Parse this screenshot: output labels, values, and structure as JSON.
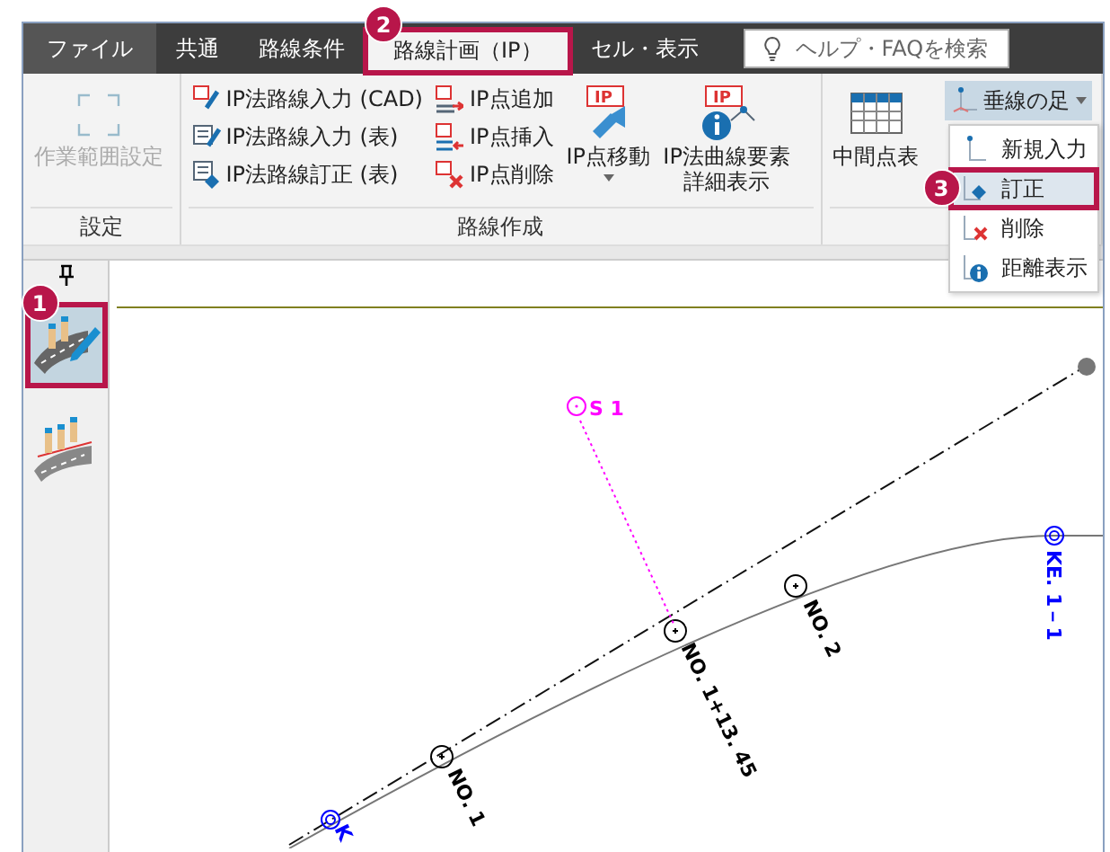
{
  "tabs": [
    {
      "label": "ファイル",
      "selected": false,
      "kind": "file"
    },
    {
      "label": "共通",
      "selected": false,
      "kind": "tab"
    },
    {
      "label": "路線条件",
      "selected": false,
      "kind": "tab"
    },
    {
      "label": "路線計画（IP）",
      "selected": true,
      "kind": "tab",
      "callout": "2"
    },
    {
      "label": "セル・表示",
      "selected": false,
      "kind": "tab"
    }
  ],
  "search": {
    "placeholder": "ヘルプ・FAQを検索"
  },
  "ribbon": {
    "groups": [
      {
        "label": "設定",
        "columns": [
          {
            "kind": "large",
            "items": [
              {
                "label": "作業範囲設定",
                "disabled": true
              }
            ]
          }
        ]
      },
      {
        "label": "路線作成",
        "columns": [
          {
            "kind": "small",
            "items": [
              {
                "label": "IP法路線入力 (CAD)",
                "disabled": false
              },
              {
                "label": "IP法路線入力 (表)",
                "disabled": false
              },
              {
                "label": "IP法路線訂正 (表)",
                "disabled": false
              }
            ]
          },
          {
            "kind": "small",
            "items": [
              {
                "label": "IP点追加",
                "disabled": false
              },
              {
                "label": "IP点挿入",
                "disabled": false
              },
              {
                "label": "IP点削除",
                "disabled": false
              }
            ]
          },
          {
            "kind": "large",
            "items": [
              {
                "label": "IP点移動",
                "disabled": false,
                "has_menu": true,
                "icon_text": "IP"
              },
              {
                "label": "IP法曲線要素詳細表示",
                "disabled": false,
                "has_menu": false,
                "icon_text": "IP"
              }
            ]
          }
        ]
      },
      {
        "columns": [
          {
            "kind": "large",
            "items": [
              {
                "label": "中間点表",
                "disabled": false,
                "has_menu": false
              }
            ]
          }
        ],
        "dropdown": {
          "label": "垂線の足",
          "expanded": true,
          "menu": [
            {
              "label": "新規入力",
              "selected": false
            },
            {
              "label": "訂正",
              "selected": true,
              "callout": "3"
            },
            {
              "label": "削除",
              "selected": false
            },
            {
              "label": "距離表示",
              "selected": false
            }
          ]
        }
      }
    ]
  },
  "toolbar": {
    "items": [
      {
        "selected": true,
        "callout": "1"
      },
      {
        "selected": false
      }
    ]
  },
  "drawing": {
    "survey_point": "S 1",
    "stations": [
      "NO. 1",
      "NO. 1+13. 45",
      "NO. 2"
    ],
    "key_points": [
      "K",
      "KE. 1－1"
    ]
  }
}
